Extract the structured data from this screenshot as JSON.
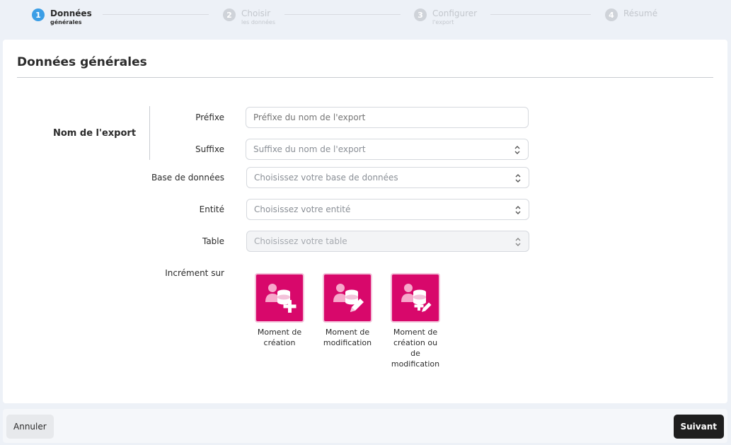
{
  "stepper": {
    "steps": [
      {
        "num": "1",
        "title": "Données",
        "sub": "générales",
        "active": true
      },
      {
        "num": "2",
        "title": "Choisir",
        "sub": "les données",
        "active": false
      },
      {
        "num": "3",
        "title": "Configurer",
        "sub": "l'export",
        "active": false
      },
      {
        "num": "4",
        "title": "Résumé",
        "sub": "",
        "active": false
      }
    ]
  },
  "card": {
    "title": "Données générales",
    "group_label": "Nom de l'export"
  },
  "form": {
    "prefix": {
      "label": "Préfixe",
      "placeholder": "Préfixe du nom de l'export",
      "value": ""
    },
    "suffix": {
      "label": "Suffixe",
      "placeholder": "Suffixe du nom de l'export",
      "value": ""
    },
    "database": {
      "label": "Base de données",
      "placeholder": "Choisissez votre base de données"
    },
    "entity": {
      "label": "Entité",
      "placeholder": "Choisissez votre entité"
    },
    "table": {
      "label": "Table",
      "placeholder": "Choisissez votre table"
    },
    "increment": {
      "label": "Incrément sur",
      "options": [
        {
          "caption": "Moment de création",
          "icon": "user-database-add-icon"
        },
        {
          "caption": "Moment de modification",
          "icon": "user-database-edit-icon"
        },
        {
          "caption": "Moment de création ou de modification",
          "icon": "user-database-add-edit-icon"
        }
      ]
    }
  },
  "footer": {
    "cancel_label": "Annuler",
    "next_label": "Suivant"
  },
  "colors": {
    "accent": "#3b9ee6",
    "tile": "#d8086b",
    "primary_button": "#1e1e1e"
  }
}
